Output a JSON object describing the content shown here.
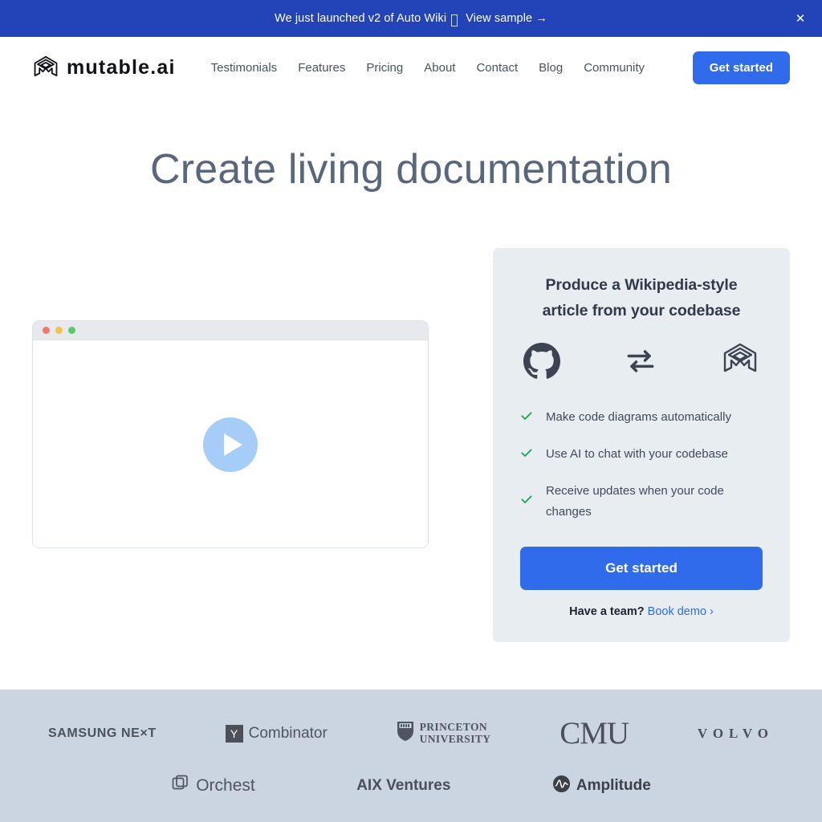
{
  "banner": {
    "text": "We just launched v2 of Auto Wiki",
    "glyph_icon": "missing-glyph-box",
    "link_label": "View sample →",
    "close_icon": "close-icon",
    "background": "#2344B8"
  },
  "nav": {
    "brand_name": "mutable.ai",
    "brand_icon": "mutable-cube-logo-icon",
    "links": [
      {
        "label": "Testimonials"
      },
      {
        "label": "Features"
      },
      {
        "label": "Pricing"
      },
      {
        "label": "About"
      },
      {
        "label": "Contact"
      },
      {
        "label": "Blog"
      },
      {
        "label": "Community"
      }
    ],
    "cta_label": "Get started",
    "cta_color": "#2F6BEB"
  },
  "hero": {
    "title": "Create living documentation",
    "title_color": "#59677c"
  },
  "video": {
    "play_icon": "play-icon",
    "traffic_lights": [
      "#f4766a",
      "#f5c344",
      "#56cc68"
    ]
  },
  "card": {
    "title_line1": "Produce a Wikipedia-style",
    "title_line2": "article from your codebase",
    "background": "#E8EDF2",
    "icons": [
      {
        "name": "github-icon"
      },
      {
        "name": "bidirectional-arrows-icon"
      },
      {
        "name": "mutable-cube-logo-icon"
      }
    ],
    "features": [
      {
        "icon": "check-icon",
        "text": "Make code diagrams automatically"
      },
      {
        "icon": "check-icon",
        "text": "Use AI to chat with your codebase"
      },
      {
        "icon": "check-icon",
        "text": "Receive updates when your code changes"
      }
    ],
    "check_color": "#22A24D",
    "cta_label": "Get started",
    "foot_text": "Have a team?",
    "foot_link": "Book demo ›"
  },
  "logobar": {
    "background": "#CBD5E1",
    "row1": [
      {
        "name": "samsung-next",
        "label": "SAMSUNG NE×T"
      },
      {
        "name": "y-combinator",
        "badge": "Y",
        "label": "Combinator"
      },
      {
        "name": "princeton-university",
        "line1": "PRINCETON",
        "line2": "UNIVERSITY"
      },
      {
        "name": "cmu",
        "label": "CMU"
      },
      {
        "name": "volvo",
        "label": "VOLVO"
      }
    ],
    "row2": [
      {
        "name": "orchest",
        "label": "Orchest"
      },
      {
        "name": "aix-ventures",
        "label": "AIX Ventures"
      },
      {
        "name": "amplitude",
        "label": "Amplitude"
      }
    ]
  }
}
